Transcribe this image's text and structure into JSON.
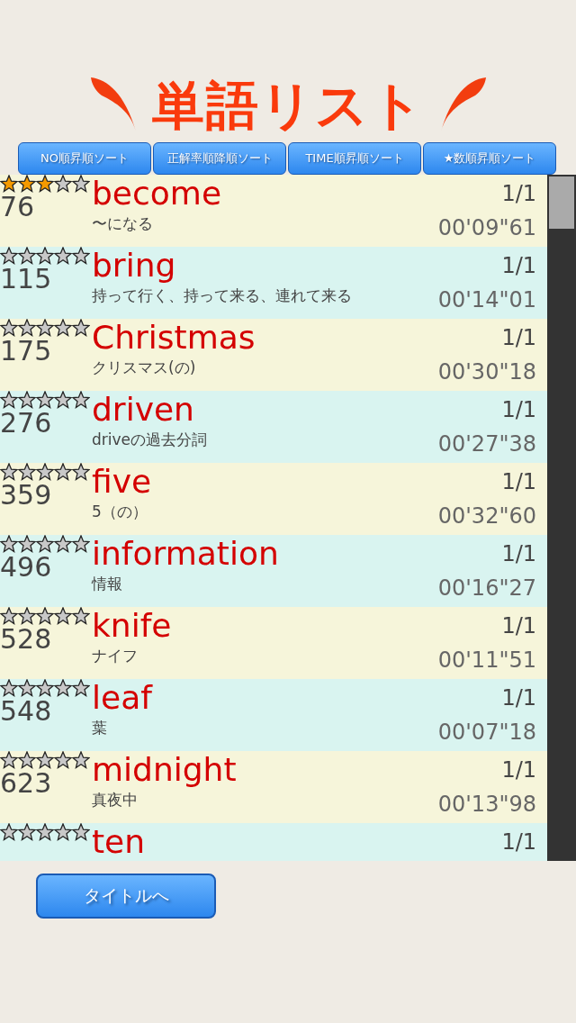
{
  "title": "単語リスト",
  "sort_buttons": [
    "NO順昇順ソート",
    "正解率順降順ソート",
    "TIME順昇順ソート",
    "★数順昇順ソート"
  ],
  "words": [
    {
      "stars": 3,
      "no": "76",
      "word": "become",
      "meaning": "〜になる",
      "score": "1/1",
      "time": "00'09\"61"
    },
    {
      "stars": 0,
      "no": "115",
      "word": "bring",
      "meaning": "持って行く、持って来る、連れて来る",
      "score": "1/1",
      "time": "00'14\"01"
    },
    {
      "stars": 0,
      "no": "175",
      "word": "Christmas",
      "meaning": "クリスマス(の)",
      "score": "1/1",
      "time": "00'30\"18"
    },
    {
      "stars": 0,
      "no": "276",
      "word": "driven",
      "meaning": "driveの過去分詞",
      "score": "1/1",
      "time": "00'27\"38"
    },
    {
      "stars": 0,
      "no": "359",
      "word": "five",
      "meaning": "5（の）",
      "score": "1/1",
      "time": "00'32\"60"
    },
    {
      "stars": 0,
      "no": "496",
      "word": "information",
      "meaning": "情報",
      "score": "1/1",
      "time": "00'16\"27"
    },
    {
      "stars": 0,
      "no": "528",
      "word": "knife",
      "meaning": "ナイフ",
      "score": "1/1",
      "time": "00'11\"51"
    },
    {
      "stars": 0,
      "no": "548",
      "word": "leaf",
      "meaning": "葉",
      "score": "1/1",
      "time": "00'07\"18"
    },
    {
      "stars": 0,
      "no": "623",
      "word": "midnight",
      "meaning": "真夜中",
      "score": "1/1",
      "time": "00'13\"98"
    },
    {
      "stars": 0,
      "word": "ten",
      "score": "1/1"
    }
  ],
  "back_button": "タイトルへ"
}
